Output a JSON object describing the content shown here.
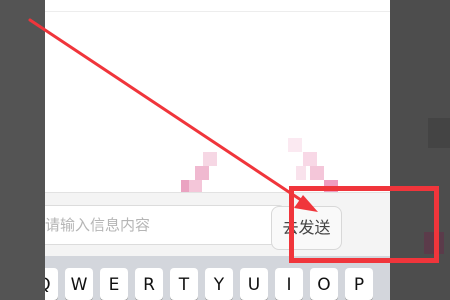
{
  "input_bar": {
    "message_placeholder": "请输入信息内容",
    "send_label": "去发送"
  },
  "keyboard": {
    "keys": [
      "Q",
      "W",
      "E",
      "R",
      "T",
      "Y",
      "U",
      "I",
      "O",
      "P"
    ]
  },
  "annotation": {
    "highlight_color": "#f0353b",
    "arrow_color": "#f0353b"
  }
}
